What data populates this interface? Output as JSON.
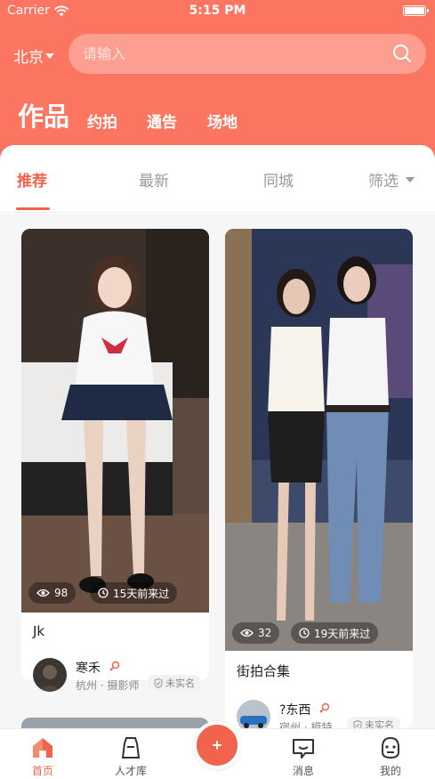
{
  "status_bar": {
    "carrier": "Carrier",
    "time": "5:15 PM"
  },
  "header": {
    "city": "北京",
    "search_placeholder": "请输入",
    "category_title": "作品",
    "category_links": [
      "约拍",
      "通告",
      "场地"
    ]
  },
  "tabs": {
    "items": [
      "推荐",
      "最新",
      "同城"
    ],
    "filter_label": "筛选"
  },
  "cards": [
    {
      "views": "98",
      "time_ago": "15天前来过",
      "title": "Jk",
      "author": "寒禾",
      "location": "杭州 · 摄影师",
      "badge": "未实名"
    },
    {
      "views": "32",
      "time_ago": "19天前来过",
      "title": "街拍合集",
      "author": "?东西",
      "location": "宿州 · 模特",
      "badge": "未实名"
    }
  ],
  "tabbar": {
    "items": [
      "首页",
      "人才库",
      "消息",
      "我的"
    ],
    "active": "首页"
  }
}
